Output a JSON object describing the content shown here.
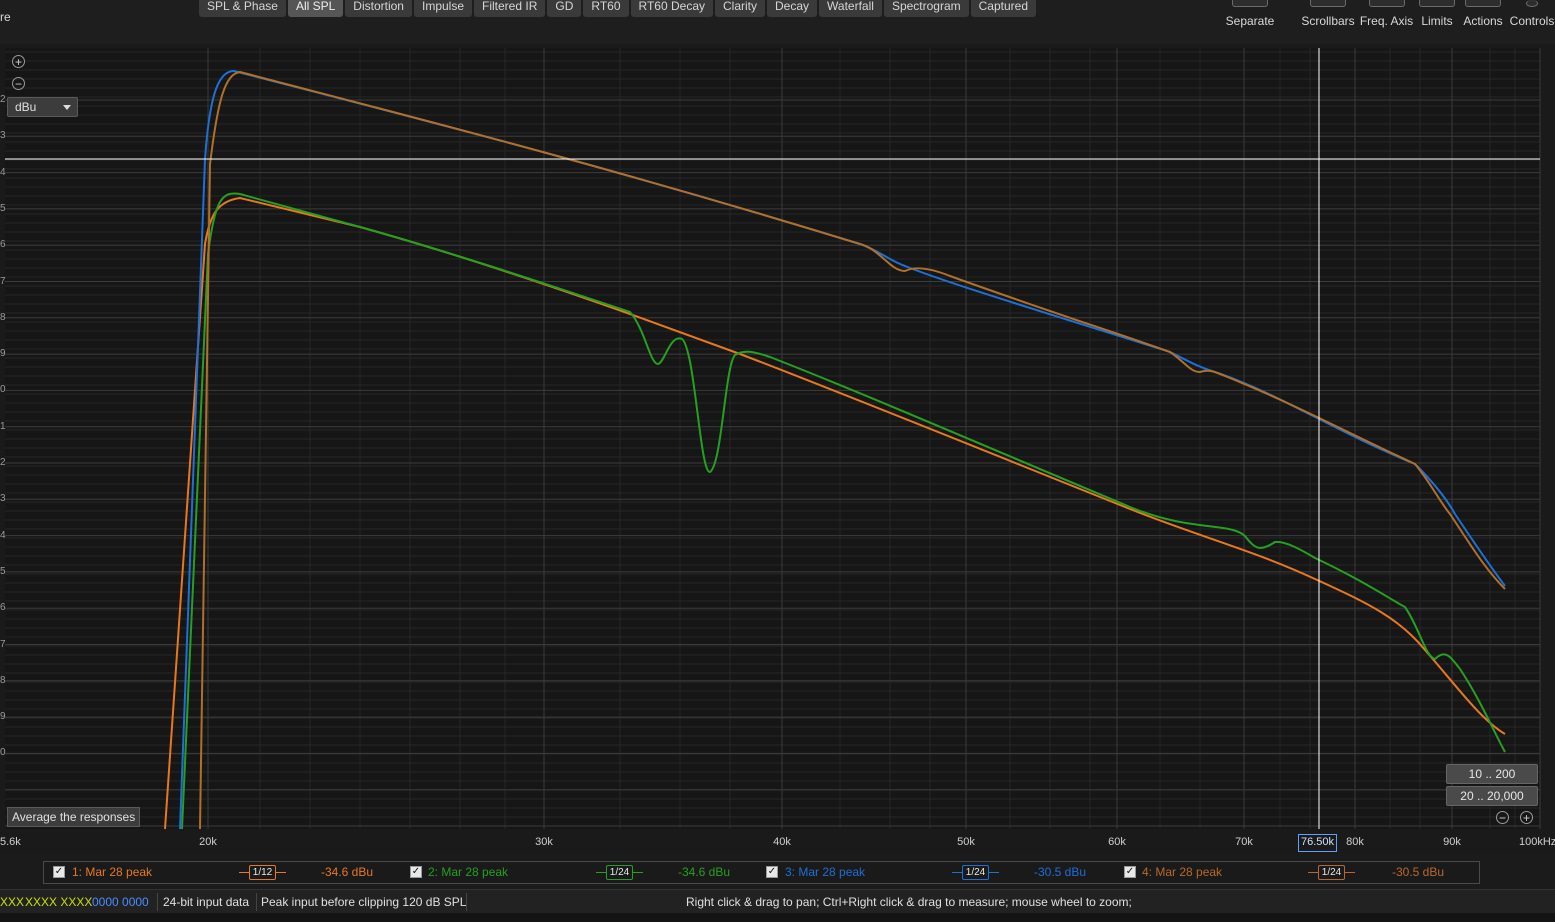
{
  "top": {
    "left_cut_text": "re",
    "tabs": [
      {
        "label": "SPL & Phase",
        "active": false
      },
      {
        "label": "All SPL",
        "active": true
      },
      {
        "label": "Distortion",
        "active": false
      },
      {
        "label": "Impulse",
        "active": false
      },
      {
        "label": "Filtered IR",
        "active": false
      },
      {
        "label": "GD",
        "active": false
      },
      {
        "label": "RT60",
        "active": false
      },
      {
        "label": "RT60 Decay",
        "active": false
      },
      {
        "label": "Clarity",
        "active": false
      },
      {
        "label": "Decay",
        "active": false
      },
      {
        "label": "Waterfall",
        "active": false
      },
      {
        "label": "Spectrogram",
        "active": false
      },
      {
        "label": "Captured",
        "active": false
      }
    ],
    "tools": {
      "separate": "Separate",
      "scrollbars": "Scrollbars",
      "freq_axis": "Freq. Axis",
      "limits": "Limits",
      "actions": "Actions",
      "controls": "Controls"
    }
  },
  "graph": {
    "unit": "dBu",
    "average_button": "Average the responses",
    "range_buttons": [
      "10 .. 200",
      "20 .. 20,000"
    ],
    "cursor_readout": "76.50k",
    "x_tick_labels": [
      "5.6k",
      "20k",
      "30k",
      "40k",
      "50k",
      "60k",
      "70k",
      "80k",
      "90k",
      "100kHz"
    ],
    "y_edge_labels": [
      "2",
      "3",
      "4",
      "5",
      "6",
      "7",
      "8",
      "9",
      "0",
      "1",
      "2",
      "3",
      "4",
      "5",
      "6",
      "7",
      "8",
      "9",
      "0"
    ],
    "colors": {
      "orange": "#e8781e",
      "green": "#25a020",
      "blue": "#1e6fd8",
      "brown": "#b07028",
      "grid": "#3a3a3a",
      "cursor": "#ffffff"
    }
  },
  "legend": [
    {
      "label": "1: Mar 28 peak",
      "smoothing": "1/12",
      "level": "-34.6 dBu",
      "color": "#e8781e",
      "checked": true
    },
    {
      "label": "2: Mar 28 peak",
      "smoothing": "1/24",
      "level": "-34.6 dBu",
      "color": "#25a020",
      "checked": true
    },
    {
      "label": "3: Mar 28 peak",
      "smoothing": "1/24",
      "level": "-30.5 dBu",
      "color": "#1e6fd8",
      "checked": true
    },
    {
      "label": "4: Mar 28 peak",
      "smoothing": "1/24",
      "level": "-30.5 dBu",
      "color": "#b8682c",
      "checked": true
    }
  ],
  "status": {
    "a": "XXX",
    "b": "XXXX XXXX",
    "c": "0000 0000",
    "d": "24-bit input data",
    "e": "Peak input before clipping 120 dB SPL",
    "hint": "Right click & drag to pan; Ctrl+Right click & drag to measure; mouse wheel to zoom;"
  }
}
